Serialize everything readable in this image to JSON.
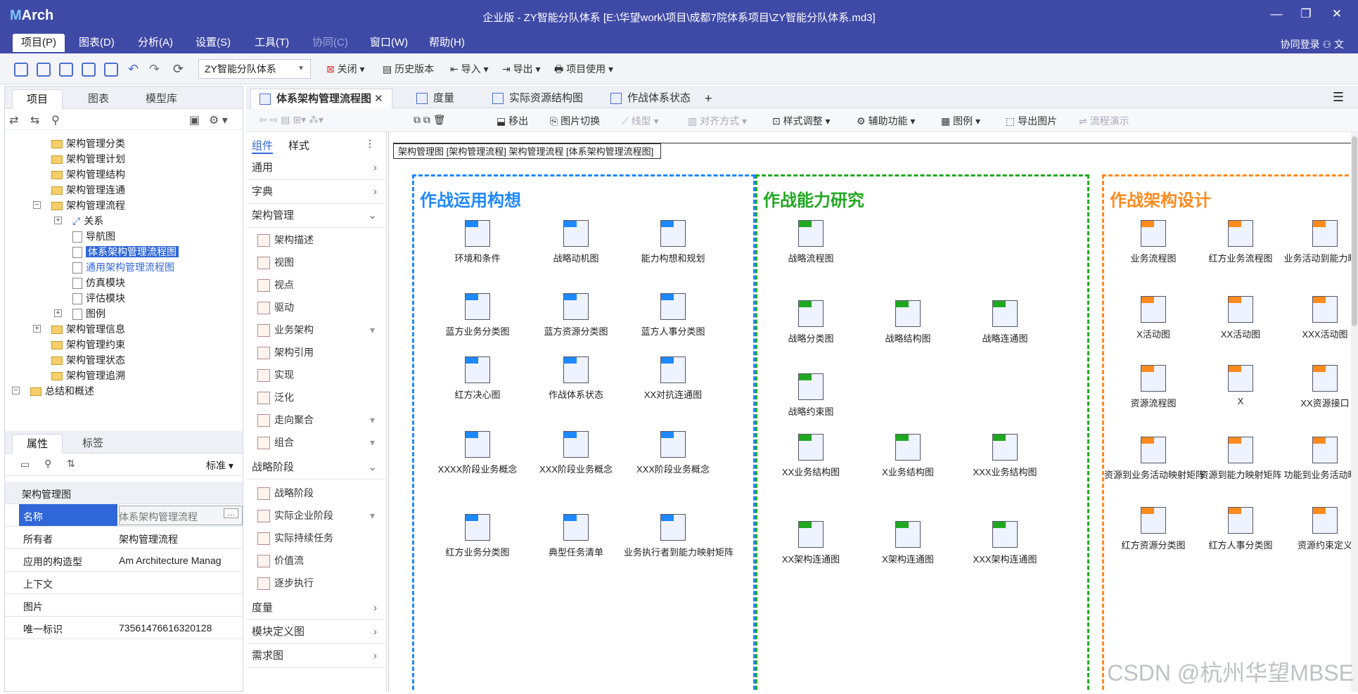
{
  "app": {
    "logo": "Arch",
    "title": "企业版 - ZY智能分队体系 [E:\\华望work\\项目\\成都7院体系项目\\ZY智能分队体系.md3]"
  },
  "menu": [
    "项目(P)",
    "图表(D)",
    "分析(A)",
    "设置(S)",
    "工具(T)",
    "协同(C)",
    "窗口(W)",
    "帮助(H)"
  ],
  "collab_login": "协同登录",
  "toolbar": {
    "combo": "ZY智能分队体系",
    "close": "关闭",
    "history": "历史版本",
    "import": "导入",
    "export": "导出",
    "project_use": "项目使用"
  },
  "left_tabs": [
    "项目",
    "图表",
    "模型库"
  ],
  "tree": [
    {
      "label": "架构管理分类"
    },
    {
      "label": "架构管理计划"
    },
    {
      "label": "架构管理结构"
    },
    {
      "label": "架构管理连通"
    },
    {
      "label": "架构管理流程"
    },
    {
      "label": "关系"
    },
    {
      "label": "导航图"
    },
    {
      "label": "体系架构管理流程图"
    },
    {
      "label": "通用架构管理流程图"
    },
    {
      "label": "仿真模块"
    },
    {
      "label": "评估模块"
    },
    {
      "label": "图例"
    },
    {
      "label": "架构管理信息"
    },
    {
      "label": "架构管理约束"
    },
    {
      "label": "架构管理状态"
    },
    {
      "label": "架构管理追溯"
    },
    {
      "label": "总结和概述"
    }
  ],
  "prop_tabs": [
    "属性",
    "标签"
  ],
  "prop_mode": "标准",
  "props": {
    "group": "架构管理图",
    "rows": [
      {
        "k": "名称",
        "v": "体系架构管理流程"
      },
      {
        "k": "所有者",
        "v": "架构管理流程"
      },
      {
        "k": "应用的构造型",
        "v": "Am Architecture Manag"
      },
      {
        "k": "上下文",
        "v": ""
      },
      {
        "k": "图片",
        "v": ""
      },
      {
        "k": "唯一标识",
        "v": "73561476616320128"
      }
    ]
  },
  "doc_tabs": [
    "体系架构管理流程图",
    "度量",
    "实际资源结构图",
    "作战体系状态"
  ],
  "doc_toolbar": [
    "移出",
    "图片切换",
    "线型",
    "对齐方式",
    "样式调整",
    "辅助功能",
    "图例",
    "导出图片",
    "流程演示"
  ],
  "palette": {
    "tabs": [
      "组件",
      "样式"
    ],
    "categories": [
      "通用",
      "字典",
      "架构管理",
      "战略阶段",
      "度量",
      "模块定义图",
      "需求图"
    ],
    "arch_items": [
      "架构描述",
      "视图",
      "视点",
      "驱动",
      "业务架构",
      "架构引用",
      "实现",
      "泛化",
      "走向聚合",
      "组合"
    ],
    "stage_items": [
      "战略阶段",
      "实际企业阶段",
      "实际持续任务",
      "价值流",
      "逐步执行"
    ]
  },
  "frame_label": "架构管理图 [架构管理流程] 架构管理流程 [体系架构管理流程图]",
  "lanes": [
    {
      "title": "作战运用构想",
      "color": "#1e88ff",
      "items": [
        "环境和条件",
        "战略动机图",
        "能力构想和规划",
        "蓝方业务分类图",
        "蓝方资源分类图",
        "蓝方人事分类图",
        "红方决心图",
        "作战体系状态",
        "XX对抗连通图",
        "XXXX阶段业务概念",
        "XXX阶段业务概念",
        "XXX阶段业务概念",
        "红方业务分类图",
        "典型任务清单",
        "业务执行者到能力映射矩阵"
      ]
    },
    {
      "title": "作战能力研究",
      "color": "#21a821",
      "items": [
        "战略流程图",
        "战略分类图",
        "战略结构图",
        "战略连通图",
        "战略约束图",
        "XX业务结构图",
        "X业务结构图",
        "XXX业务结构图",
        "XX架构连通图",
        "X架构连通图",
        "XXX架构连通图"
      ]
    },
    {
      "title": "作战架构设计",
      "color": "#ff8a1e",
      "items": [
        "业务流程图",
        "红方业务流程图",
        "业务活动到能力映射",
        "X活动图",
        "XX活动图",
        "XXX活动图",
        "资源流程图",
        "X",
        "XX资源接口",
        "资源到业务活动映射矩阵",
        "资源到能力映射矩阵",
        "功能到业务活动映射",
        "红方资源分类图",
        "红方人事分类图",
        "资源约束定义"
      ]
    }
  ],
  "watermark": "CSDN @杭州华望MBSE"
}
